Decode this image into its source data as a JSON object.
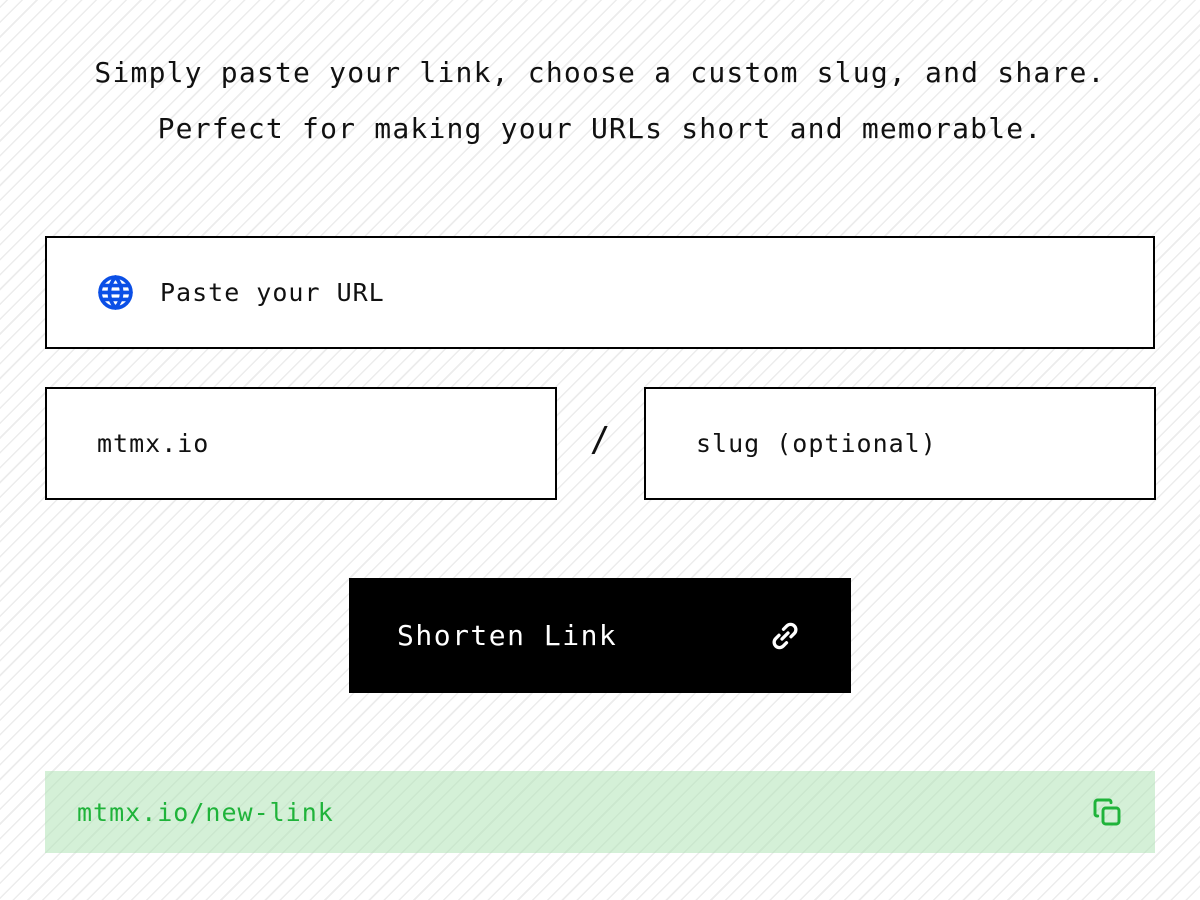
{
  "intro": {
    "line1": "Simply paste your link, choose a custom slug, and share.",
    "line2": "Perfect for making your URLs short and memorable."
  },
  "form": {
    "url_input": {
      "icon": "globe-icon",
      "value": "",
      "placeholder": "Paste your URL"
    },
    "domain_input": {
      "value": "mtmx.io",
      "placeholder": ""
    },
    "separator": "/",
    "slug_input": {
      "value": "",
      "placeholder": "slug (optional)"
    },
    "submit": {
      "label": "Shorten Link",
      "icon": "link-icon"
    }
  },
  "result": {
    "short_url": "mtmx.io/new-link",
    "copy_icon": "copy-icon"
  },
  "colors": {
    "accent_blue": "#0b4fe6",
    "success_green": "#1fb33a",
    "success_bg": "#d3efd6",
    "button_bg": "#000000",
    "border": "#000000"
  }
}
